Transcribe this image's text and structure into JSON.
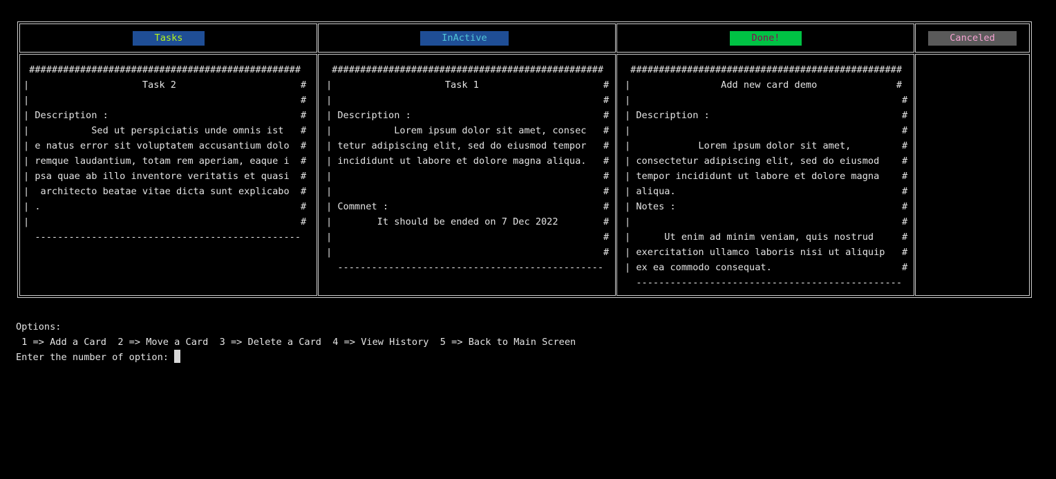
{
  "columns": [
    {
      "label": "Tasks",
      "bg": "#1f4e96",
      "fg": "#b8f51a",
      "card_lines": [
        " ################################################",
        "|                    Task 2                      #",
        "|                                                #",
        "| Description :                                  #",
        "|           Sed ut perspiciatis unde omnis ist   #",
        "| e natus error sit voluptatem accusantium dolo  #",
        "| remque laudantium, totam rem aperiam, eaque i  #",
        "| psa quae ab illo inventore veritatis et quasi  #",
        "|  architecto beatae vitae dicta sunt explicabo  #",
        "| .                                              #",
        "|                                                #",
        "  -----------------------------------------------"
      ]
    },
    {
      "label": "InActive",
      "bg": "#1f4e96",
      "fg": "#52c6d8",
      "card_lines": [
        " ################################################",
        "|                    Task 1                      #",
        "|                                                #",
        "| Description :                                  #",
        "|           Lorem ipsum dolor sit amet, consec   #",
        "| tetur adipiscing elit, sed do eiusmod tempor   #",
        "| incididunt ut labore et dolore magna aliqua.   #",
        "|                                                #",
        "|                                                #",
        "| Commnet :                                      #",
        "|        It should be ended on 7 Dec 2022        #",
        "|                                                #",
        "|                                                #",
        "  -----------------------------------------------"
      ]
    },
    {
      "label": "Done!",
      "bg": "#00c244",
      "fg": "#8a0a4f",
      "card_lines": [
        " ################################################",
        "|                Add new card demo              #",
        "|                                                #",
        "| Description :                                  #",
        "|                                                #",
        "|            Lorem ipsum dolor sit amet,         #",
        "| consectetur adipiscing elit, sed do eiusmod    #",
        "| tempor incididunt ut labore et dolore magna    #",
        "| aliqua.                                        #",
        "| Notes :                                        #",
        "|                                                #",
        "|      Ut enim ad minim veniam, quis nostrud     #",
        "| exercitation ullamco laboris nisi ut aliquip   #",
        "| ex ea commodo consequat.                       #",
        "  -----------------------------------------------"
      ]
    },
    {
      "label": "Canceled",
      "bg": "#5a5a5a",
      "fg": "#f7a3d3",
      "card_lines": []
    }
  ],
  "terminal": {
    "options_heading": "Options:",
    "options_line": " 1 => Add a Card  2 => Move a Card  3 => Delete a Card  4 => View History  5 => Back to Main Screen",
    "prompt": "Enter the number of option: "
  }
}
